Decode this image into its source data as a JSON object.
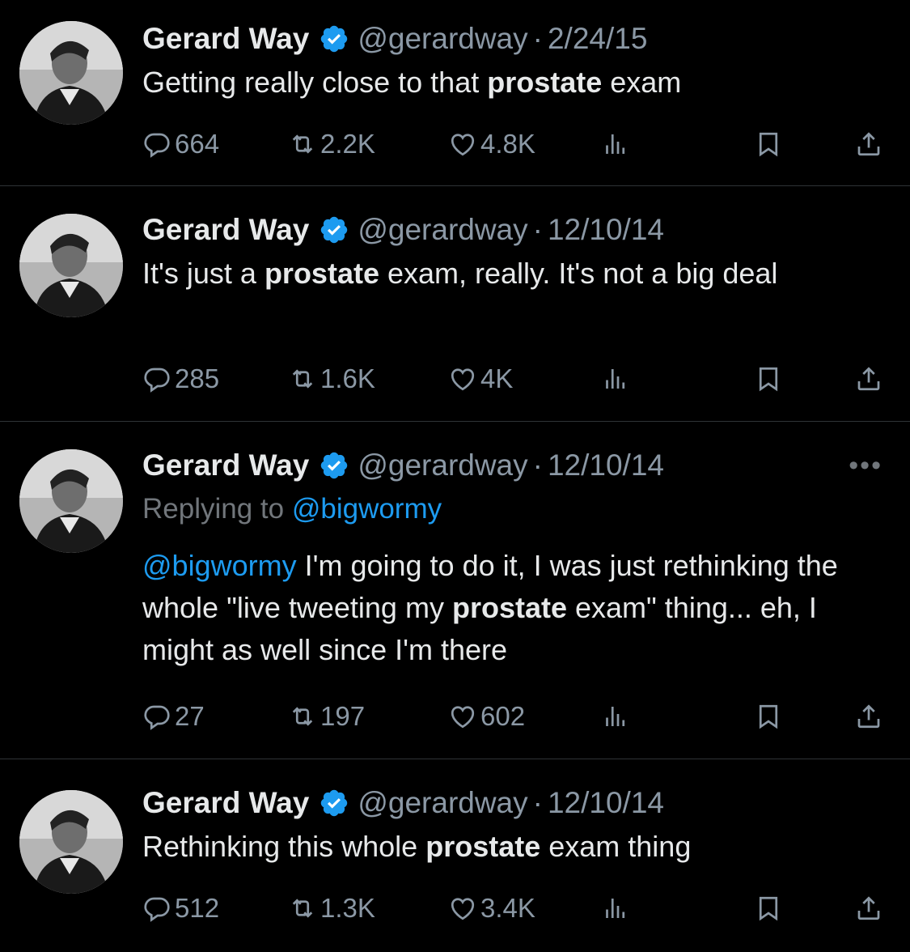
{
  "tweets": [
    {
      "name": "Gerard Way",
      "handle": "@gerardway",
      "sep": "·",
      "date": "2/24/15",
      "text_before": "Getting really close to that ",
      "text_bold": "prostate",
      "text_after": " exam",
      "replies": "664",
      "retweets": "2.2K",
      "likes": "4.8K"
    },
    {
      "name": "Gerard Way",
      "handle": "@gerardway",
      "sep": "·",
      "date": "12/10/14",
      "text_before": "It's just a ",
      "text_bold": "prostate",
      "text_after": " exam, really. It's not a big deal",
      "replies": "285",
      "retweets": "1.6K",
      "likes": "4K"
    },
    {
      "name": "Gerard Way",
      "handle": "@gerardway",
      "sep": "·",
      "date": "12/10/14",
      "more": "•••",
      "replying_label": "Replying to ",
      "replying_to": "@bigwormy",
      "mention": "@bigwormy",
      "text_before": " I'm going to do it, I was just rethinking the whole \"live tweeting my ",
      "text_bold": "prostate",
      "text_after": " exam\" thing... eh, I might as well since I'm there",
      "replies": "27",
      "retweets": "197",
      "likes": "602"
    },
    {
      "name": "Gerard Way",
      "handle": "@gerardway",
      "sep": "·",
      "date": "12/10/14",
      "text_before": "Rethinking this whole ",
      "text_bold": "prostate",
      "text_after": " exam thing",
      "replies": "512",
      "retweets": "1.3K",
      "likes": "3.4K"
    }
  ],
  "icons": {
    "reply": "reply-icon",
    "retweet": "retweet-icon",
    "like": "heart-icon",
    "views": "views-icon",
    "bookmark": "bookmark-icon",
    "share": "share-icon",
    "verified": "verified-badge-icon"
  },
  "colors": {
    "background": "#000000",
    "text": "#e7e9ea",
    "muted": "#71767b",
    "accent": "#1d9bf0",
    "divider": "#2f3336"
  }
}
